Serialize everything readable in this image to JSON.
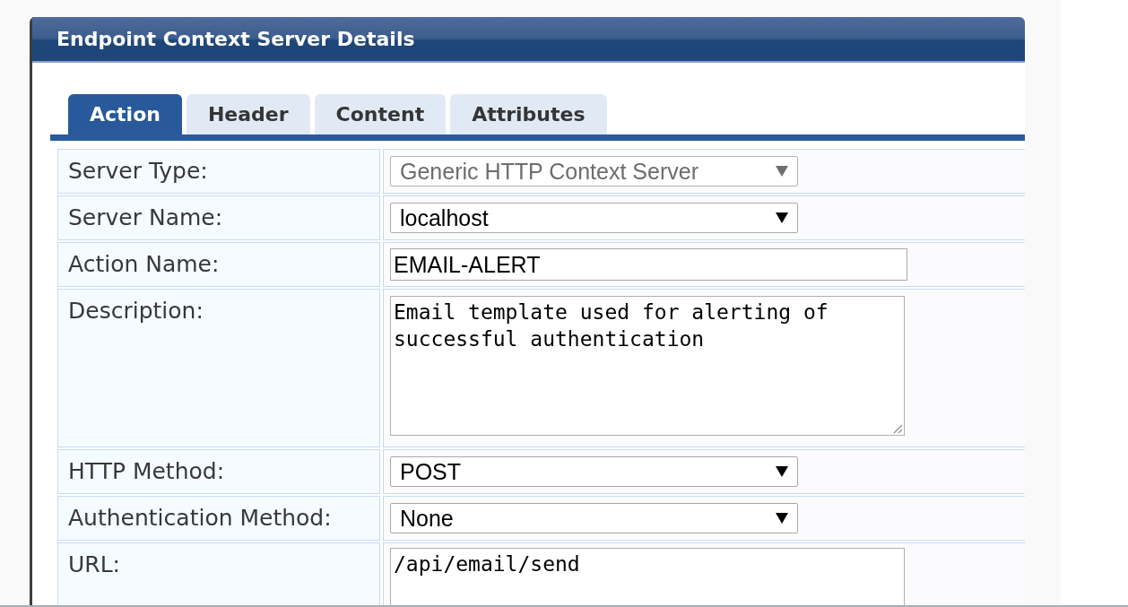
{
  "panel": {
    "title": "Endpoint Context Server Details"
  },
  "tabs": [
    {
      "label": "Action",
      "selected": true
    },
    {
      "label": "Header",
      "selected": false
    },
    {
      "label": "Content",
      "selected": false
    },
    {
      "label": "Attributes",
      "selected": false
    }
  ],
  "fields": [
    {
      "label": "Server Type:",
      "kind": "select",
      "value": "Generic HTTP Context Server",
      "disabled": true
    },
    {
      "label": "Server Name:",
      "kind": "select",
      "value": "localhost",
      "disabled": false
    },
    {
      "label": "Action Name:",
      "kind": "text",
      "value": "EMAIL-ALERT",
      "disabled": false
    },
    {
      "label": "Description:",
      "kind": "textarea",
      "value": "Email template used for alerting of successful authentication",
      "disabled": false
    },
    {
      "label": "HTTP Method:",
      "kind": "select",
      "value": "POST",
      "disabled": false
    },
    {
      "label": "Authentication Method:",
      "kind": "select",
      "value": "None",
      "disabled": false
    },
    {
      "label": "URL:",
      "kind": "textarea",
      "value": "/api/email/send",
      "disabled": false
    }
  ]
}
